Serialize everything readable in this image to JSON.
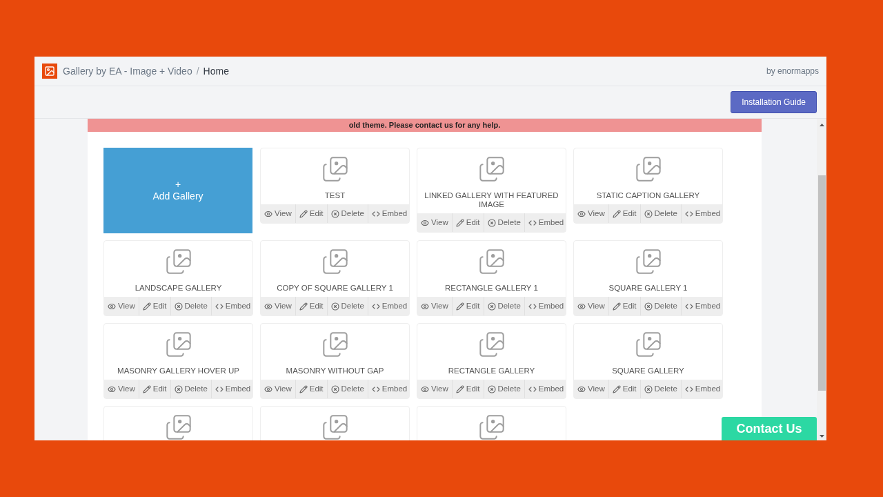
{
  "header": {
    "app_name": "Gallery by EA - Image + Video",
    "separator": "/",
    "page": "Home",
    "vendor": "by enormapps"
  },
  "toolbar": {
    "button": "Installation Guide"
  },
  "alert": {
    "text": "old theme. Please contact us for any help."
  },
  "add_gallery": {
    "plus": "+",
    "label": "Add Gallery"
  },
  "galleries": [
    {
      "kind": "full",
      "title": "TEST",
      "actions": [
        "View",
        "Edit",
        "Delete",
        "Embed"
      ]
    },
    {
      "kind": "full",
      "title": "LINKED GALLERY WITH FEATURED IMAGE",
      "actions": [
        "View",
        "Edit",
        "Delete",
        "Embed"
      ]
    },
    {
      "kind": "full",
      "title": "STATIC CAPTION GALLERY",
      "actions": [
        "View",
        "Edit",
        "Delete",
        "Embed"
      ]
    },
    {
      "kind": "full",
      "title": "LANDSCAPE GALLERY",
      "actions": [
        "View",
        "Edit",
        "Delete",
        "Embed"
      ]
    },
    {
      "kind": "full",
      "title": "COPY OF SQUARE GALLERY 1",
      "actions": [
        "View",
        "Edit",
        "Delete",
        "Embed"
      ]
    },
    {
      "kind": "full",
      "title": "RECTANGLE GALLERY 1",
      "actions": [
        "View",
        "Edit",
        "Delete",
        "Embed"
      ]
    },
    {
      "kind": "full",
      "title": "SQUARE GALLERY 1",
      "actions": [
        "View",
        "Edit",
        "Delete",
        "Embed"
      ]
    },
    {
      "kind": "full",
      "title": "MASONRY GALLERY HOVER UP",
      "actions": [
        "View",
        "Edit",
        "Delete",
        "Embed"
      ]
    },
    {
      "kind": "full",
      "title": "MASONRY WITHOUT GAP",
      "actions": [
        "View",
        "Edit",
        "Delete",
        "Embed"
      ]
    },
    {
      "kind": "full",
      "title": "RECTANGLE GALLERY",
      "actions": [
        "View",
        "Edit",
        "Delete",
        "Embed"
      ]
    },
    {
      "kind": "full",
      "title": "SQUARE GALLERY",
      "actions": [
        "View",
        "Edit",
        "Delete",
        "Embed"
      ]
    },
    {
      "kind": "cut"
    },
    {
      "kind": "cut"
    },
    {
      "kind": "cut"
    }
  ],
  "contact_button": "Contact Us"
}
